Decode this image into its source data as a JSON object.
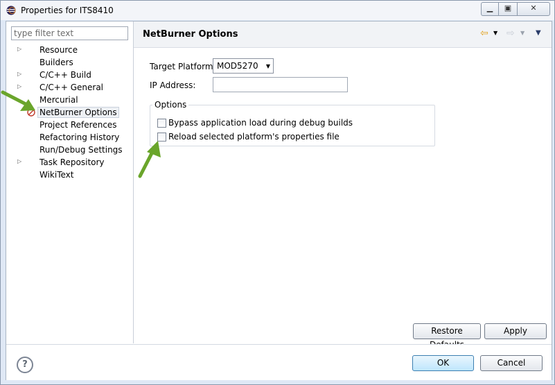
{
  "window": {
    "title": "Properties for ITS8410"
  },
  "filter": {
    "placeholder": "type filter text"
  },
  "tree": {
    "items": [
      {
        "label": "Resource",
        "expandable": true
      },
      {
        "label": "Builders",
        "expandable": false
      },
      {
        "label": "C/C++ Build",
        "expandable": true
      },
      {
        "label": "C/C++ General",
        "expandable": true
      },
      {
        "label": "Mercurial",
        "expandable": false
      },
      {
        "label": "NetBurner Options",
        "expandable": false,
        "selected": true
      },
      {
        "label": "Project References",
        "expandable": false
      },
      {
        "label": "Refactoring History",
        "expandable": false
      },
      {
        "label": "Run/Debug Settings",
        "expandable": false
      },
      {
        "label": "Task Repository",
        "expandable": true
      },
      {
        "label": "WikiText",
        "expandable": false
      }
    ]
  },
  "page": {
    "title": "NetBurner Options",
    "target_platform_label": "Target Platform:",
    "target_platform_value": "MOD5270",
    "ip_address_label": "IP Address:",
    "ip_address_value": "",
    "options_group_title": "Options",
    "option_bypass": "Bypass application load during debug builds",
    "option_reload": "Reload selected platform's properties file",
    "restore_defaults_label": "Restore Defaults",
    "apply_label": "Apply"
  },
  "dialog": {
    "ok_label": "OK",
    "cancel_label": "Cancel"
  },
  "colors": {
    "accent_arrow": "#6aa52b",
    "nav_back": "#e2a21f",
    "window_frame": "#dfe8f5"
  }
}
